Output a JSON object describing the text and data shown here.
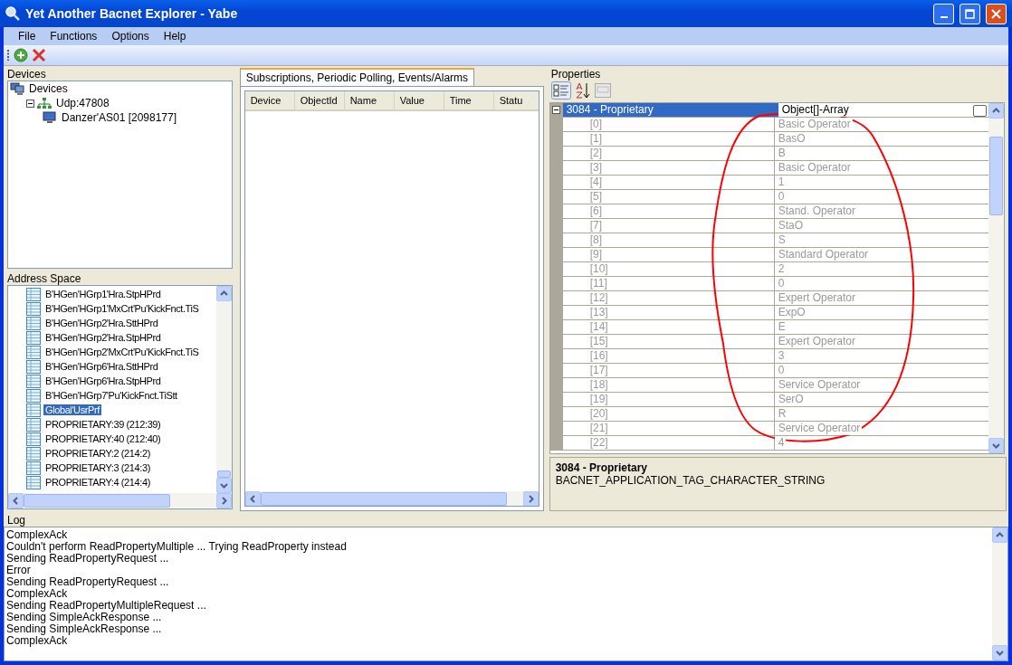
{
  "window": {
    "title": "Yet Another Bacnet Explorer - Yabe"
  },
  "menu": [
    "File",
    "Functions",
    "Options",
    "Help"
  ],
  "devices": {
    "title": "Devices",
    "tree": [
      {
        "label": "Devices",
        "kind": "root",
        "children": [
          {
            "label": "Udp:47808",
            "kind": "network",
            "expanded": true,
            "children": [
              {
                "label": "Danzer'AS01 [2098177]",
                "kind": "device"
              }
            ]
          }
        ]
      }
    ]
  },
  "address_space": {
    "title": "Address Space",
    "items": [
      {
        "label": "B'HGen'HGrp1'Hra.StpHPrd",
        "selected": false
      },
      {
        "label": "B'HGen'HGrp1'MxCrt'Pu'KickFnct.TiS",
        "selected": false
      },
      {
        "label": "B'HGen'HGrp2'Hra.SttHPrd",
        "selected": false
      },
      {
        "label": "B'HGen'HGrp2'Hra.StpHPrd",
        "selected": false
      },
      {
        "label": "B'HGen'HGrp2'MxCrt'Pu'KickFnct.TiS",
        "selected": false
      },
      {
        "label": "B'HGen'HGrp6'Hra.SttHPrd",
        "selected": false
      },
      {
        "label": "B'HGen'HGrp6'Hra.StpHPrd",
        "selected": false
      },
      {
        "label": "B'HGen'HGrp7'Pu'KickFnct.TiStt",
        "selected": false
      },
      {
        "label": "Global'UsrPrf",
        "selected": true
      },
      {
        "label": "PROPRIETARY:39 (212:39)",
        "selected": false
      },
      {
        "label": "PROPRIETARY:40 (212:40)",
        "selected": false
      },
      {
        "label": "PROPRIETARY:2 (214:2)",
        "selected": false
      },
      {
        "label": "PROPRIETARY:3 (214:3)",
        "selected": false
      },
      {
        "label": "PROPRIETARY:4 (214:4)",
        "selected": false
      }
    ]
  },
  "subscriptions": {
    "tab": "Subscriptions, Periodic Polling, Events/Alarms",
    "columns": [
      "Device",
      "ObjectId",
      "Name",
      "Value",
      "Time",
      "Statu"
    ]
  },
  "properties": {
    "title": "Properties",
    "category": {
      "label": "3084 - Proprietary",
      "value": "Object[]-Array",
      "expanded": true,
      "selected": true
    },
    "items": [
      {
        "index": "[0]",
        "value": "Basic Operator"
      },
      {
        "index": "[1]",
        "value": "BasO"
      },
      {
        "index": "[2]",
        "value": "B"
      },
      {
        "index": "[3]",
        "value": "Basic Operator"
      },
      {
        "index": "[4]",
        "value": "1"
      },
      {
        "index": "[5]",
        "value": "0"
      },
      {
        "index": "[6]",
        "value": "Stand. Operator"
      },
      {
        "index": "[7]",
        "value": "StaO"
      },
      {
        "index": "[8]",
        "value": "S"
      },
      {
        "index": "[9]",
        "value": "Standard Operator"
      },
      {
        "index": "[10]",
        "value": "2"
      },
      {
        "index": "[11]",
        "value": "0"
      },
      {
        "index": "[12]",
        "value": "Expert Operator"
      },
      {
        "index": "[13]",
        "value": "ExpO"
      },
      {
        "index": "[14]",
        "value": "E"
      },
      {
        "index": "[15]",
        "value": "Expert Operator"
      },
      {
        "index": "[16]",
        "value": "3"
      },
      {
        "index": "[17]",
        "value": "0"
      },
      {
        "index": "[18]",
        "value": "Service Operator"
      },
      {
        "index": "[19]",
        "value": "SerO"
      },
      {
        "index": "[20]",
        "value": "R"
      },
      {
        "index": "[21]",
        "value": "Service Operator"
      },
      {
        "index": "[22]",
        "value": "4"
      }
    ],
    "description": {
      "title": "3084 - Proprietary",
      "text": "BACNET_APPLICATION_TAG_CHARACTER_STRING"
    }
  },
  "log": {
    "title": "Log",
    "lines": [
      "ComplexAck",
      "Couldn't perform ReadPropertyMultiple ... Trying ReadProperty instead",
      "Sending ReadPropertyRequest ...",
      "Error",
      "Sending ReadPropertyRequest ...",
      "ComplexAck",
      "Sending ReadPropertyMultipleRequest ...",
      "Sending SimpleAckResponse ...",
      "Sending SimpleAckResponse ...",
      "ComplexAck"
    ]
  }
}
